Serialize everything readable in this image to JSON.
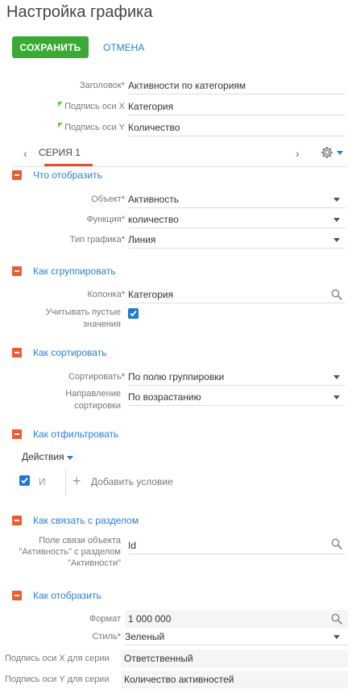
{
  "page_title": "Настройка графика",
  "buttons": {
    "save": "СОХРАНИТЬ",
    "cancel": "ОТМЕНА"
  },
  "general": {
    "title_label": "Заголовок",
    "title_value": "Активности по категориям",
    "x_axis_label": "Подпись оси X",
    "x_axis_value": "Категория",
    "y_axis_label": "Подпись оси Y",
    "y_axis_value": "Количество"
  },
  "series_tab": {
    "label": "СЕРИЯ 1"
  },
  "sections": {
    "what": {
      "title": "Что отобразить",
      "object_label": "Объект",
      "object_value": "Активность",
      "function_label": "Функция",
      "function_value": "количество",
      "chart_type_label": "Тип графика",
      "chart_type_value": "Линия"
    },
    "group": {
      "title": "Как сгруппировать",
      "column_label": "Колонка",
      "column_value": "Категория",
      "empty_label_1": "Учитывать пустые",
      "empty_label_2": "значения",
      "empty_checked": true
    },
    "sort": {
      "title": "Как сортировать",
      "sort_label": "Сортировать",
      "sort_value": "По полю группировки",
      "direction_label_1": "Направление",
      "direction_label_2": "сортировки",
      "direction_value": "По возрастанию"
    },
    "filter": {
      "title": "Как отфильтровать",
      "actions": "Действия",
      "and_label": "И",
      "add_condition": "Добавить условие"
    },
    "link": {
      "title": "Как связать с разделом",
      "field_label_1": "Поле связи объекта",
      "field_label_2": "\"Активность\" с разделом",
      "field_label_3": "\"Активности\"",
      "field_value": "Id"
    },
    "display": {
      "title": "Как отобразить",
      "format_label": "Формат",
      "format_value": "1 000 000",
      "style_label": "Стиль",
      "style_value": "Зеленый",
      "x_series_label": "Подпись оси X для серии",
      "x_series_value": "Ответственный",
      "y_series_label": "Подпись оси Y для серии",
      "y_series_value": "Количество активностей"
    }
  },
  "colors": {
    "accent_green": "#3aaa35",
    "link_blue": "#2a7ed0",
    "section_orange": "#ef5b30",
    "checkbox_blue": "#1f78d1"
  },
  "icons": [
    "magnifier-icon",
    "gear-icon",
    "chevron-left-icon",
    "chevron-right-icon",
    "dropdown-arrow-icon",
    "collapse-icon",
    "checkmark-icon",
    "plus-icon"
  ]
}
